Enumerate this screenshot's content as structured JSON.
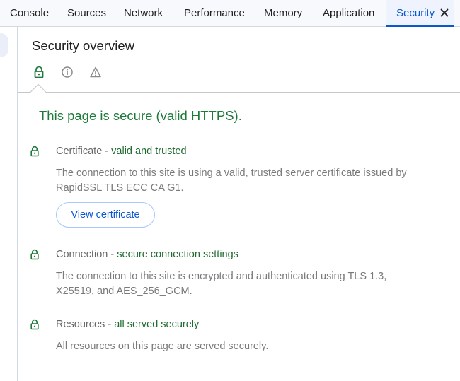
{
  "tabs": [
    {
      "label": "Console"
    },
    {
      "label": "Sources"
    },
    {
      "label": "Network"
    },
    {
      "label": "Performance"
    },
    {
      "label": "Memory"
    },
    {
      "label": "Application"
    },
    {
      "label": "Security",
      "active": true
    }
  ],
  "panel": {
    "title": "Security overview",
    "view_icons": [
      "lock-icon",
      "info-icon",
      "warning-icon"
    ],
    "summary": "This page is secure (valid HTTPS).",
    "sections": [
      {
        "name": "Certificate",
        "separator": " - ",
        "status": "valid and trusted",
        "description": "The connection to this site is using a valid, trusted server certificate issued by RapidSSL TLS ECC CA G1.",
        "button": "View certificate"
      },
      {
        "name": "Connection",
        "separator": " - ",
        "status": "secure connection settings",
        "description": "The connection to this site is encrypted and authenticated using TLS 1.3, X25519, and AES_256_GCM."
      },
      {
        "name": "Resources",
        "separator": " - ",
        "status": "all served securely",
        "description": "All resources on this page are served securely."
      }
    ]
  },
  "colors": {
    "accent": "#0b57d0",
    "secure_green": "#1e7a3a",
    "muted_text": "#7a7a7a"
  }
}
